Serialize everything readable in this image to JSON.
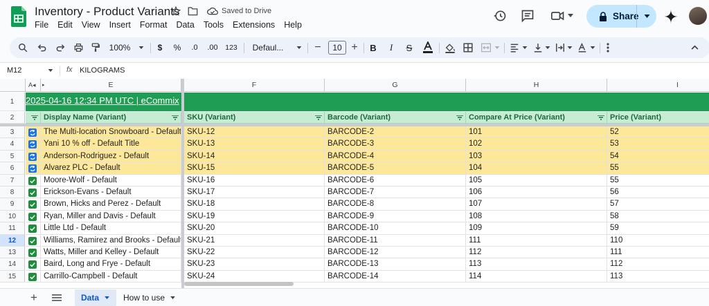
{
  "app": {
    "title": "Inventory - Product Variants",
    "saved_status": "Saved to Drive",
    "share_label": "Share",
    "menu": [
      "File",
      "Edit",
      "View",
      "Insert",
      "Format",
      "Data",
      "Tools",
      "Extensions",
      "Help"
    ]
  },
  "toolbar": {
    "zoom": "100%",
    "currency": "$",
    "percent": "%",
    "decimal_decrease": ".0",
    "decimal_increase": ".00",
    "number_format": "123",
    "font": "Defaul...",
    "font_size": "10"
  },
  "formula_bar": {
    "name_box": "M12",
    "fx": "fx",
    "value": "KILOGRAMS"
  },
  "columns": {
    "A": "A",
    "E": "E",
    "F": "F",
    "G": "G",
    "H": "H",
    "I": "I"
  },
  "banner": "2025-04-16 12:34 PM UTC | eCommix",
  "headers": {
    "display_name": "Display Name (Variant)",
    "sku": "SKU (Variant)",
    "barcode": "Barcode (Variant)",
    "compare_price": "Compare At Price (Variant)",
    "price": "Price (Variant)"
  },
  "rows": [
    {
      "n": "3",
      "name": "The Multi-location Snowboard - Default Title",
      "sku": "SKU-12",
      "barcode": "BARCODE-2",
      "compare": "101",
      "price": "52",
      "status": "sync"
    },
    {
      "n": "4",
      "name": "Yani 10 % off - Default Title",
      "sku": "SKU-13",
      "barcode": "BARCODE-3",
      "compare": "102",
      "price": "53",
      "status": "sync"
    },
    {
      "n": "5",
      "name": "Anderson-Rodriguez - Default",
      "sku": "SKU-14",
      "barcode": "BARCODE-4",
      "compare": "103",
      "price": "54",
      "status": "sync"
    },
    {
      "n": "6",
      "name": "Alvarez PLC - Default",
      "sku": "SKU-15",
      "barcode": "BARCODE-5",
      "compare": "104",
      "price": "55",
      "status": "sync"
    },
    {
      "n": "7",
      "name": "Moore-Wolf - Default",
      "sku": "SKU-16",
      "barcode": "BARCODE-6",
      "compare": "105",
      "price": "55",
      "status": "ok"
    },
    {
      "n": "8",
      "name": "Erickson-Evans - Default",
      "sku": "SKU-17",
      "barcode": "BARCODE-7",
      "compare": "106",
      "price": "56",
      "status": "ok"
    },
    {
      "n": "9",
      "name": "Brown, Hicks and Perez - Default",
      "sku": "SKU-18",
      "barcode": "BARCODE-8",
      "compare": "107",
      "price": "57",
      "status": "ok"
    },
    {
      "n": "10",
      "name": "Ryan, Miller and Davis - Default",
      "sku": "SKU-19",
      "barcode": "BARCODE-9",
      "compare": "108",
      "price": "58",
      "status": "ok"
    },
    {
      "n": "11",
      "name": "Little Ltd - Default",
      "sku": "SKU-20",
      "barcode": "BARCODE-10",
      "compare": "109",
      "price": "59",
      "status": "ok"
    },
    {
      "n": "12",
      "name": "Williams, Ramirez and Brooks - Default",
      "sku": "SKU-21",
      "barcode": "BARCODE-11",
      "compare": "111",
      "price": "110",
      "status": "ok"
    },
    {
      "n": "13",
      "name": "Watts, Miller and Kelley - Default",
      "sku": "SKU-22",
      "barcode": "BARCODE-12",
      "compare": "112",
      "price": "111",
      "status": "ok"
    },
    {
      "n": "14",
      "name": "Baird, Long and Frye - Default",
      "sku": "SKU-23",
      "barcode": "BARCODE-13",
      "compare": "113",
      "price": "112",
      "status": "ok"
    },
    {
      "n": "15",
      "name": "Carrillo-Campbell - Default",
      "sku": "SKU-24",
      "barcode": "BARCODE-14",
      "compare": "114",
      "price": "113",
      "status": "ok"
    }
  ],
  "row_numbers": {
    "r1": "1",
    "r2": "2"
  },
  "sheets": {
    "active": "Data",
    "other": "How to use"
  },
  "colors": {
    "accent_green": "#1f9d55",
    "header_green": "#c7ecd5",
    "highlight_yellow": "#fde89a",
    "share_blue": "#c2e7ff",
    "check_green": "#1e8e3e",
    "sync_blue": "#1a73e8"
  }
}
